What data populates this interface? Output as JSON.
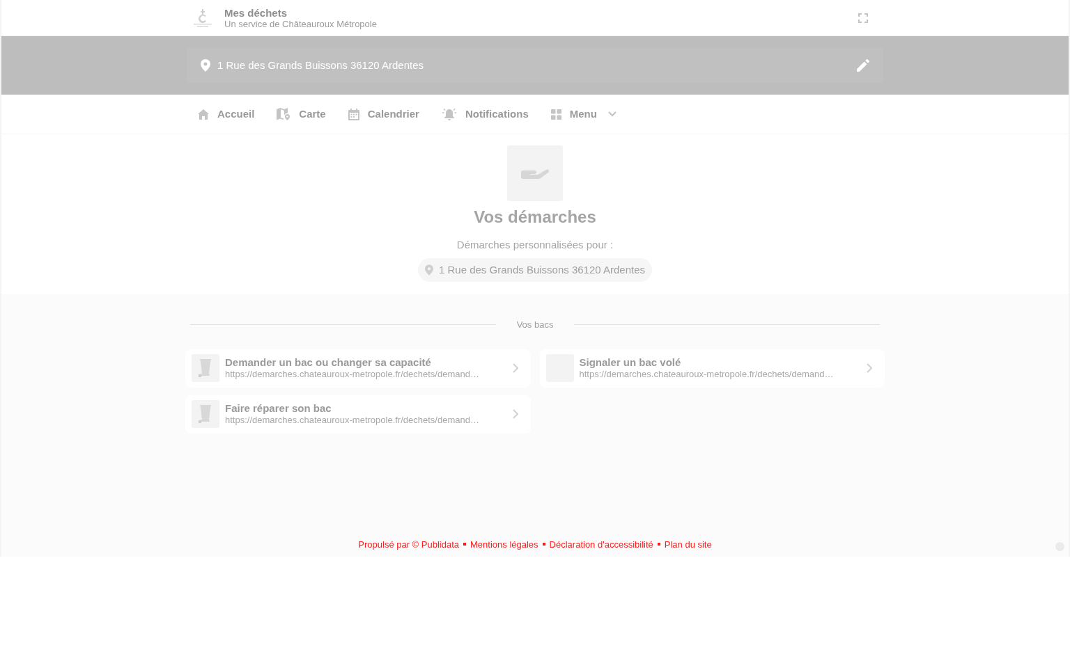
{
  "header": {
    "title": "Mes déchets",
    "subtitle": "Un service de Châteauroux Métropole"
  },
  "address_bar": {
    "address": "1 Rue des Grands Buissons 36120 Ardentes"
  },
  "nav": [
    {
      "label": "Accueil",
      "kind": "link",
      "selected": false
    },
    {
      "label": "Carte",
      "kind": "link",
      "selected": false
    },
    {
      "label": "Calendrier",
      "kind": "link",
      "selected": false
    },
    {
      "label": "Notifications",
      "kind": "link",
      "selected": false
    },
    {
      "label": "Menu",
      "kind": "dropdown",
      "selected": false,
      "expanded": false
    }
  ],
  "hero": {
    "title": "Vos démarches",
    "subtitle": "Démarches personnalisées pour :",
    "address": "1 Rue des Grands Buissons 36120 Ardentes"
  },
  "section": {
    "title": "Vos bacs",
    "items": [
      {
        "title": "Demander un bac ou changer sa capacité",
        "url": "https://demarches.chateauroux-metropole.fr/dechets/demand…",
        "kind": "bin"
      },
      {
        "title": "Signaler un bac volé",
        "url": "https://demarches.chateauroux-metropole.fr/dechets/demand…",
        "kind": "plain"
      },
      {
        "title": "Faire réparer son bac",
        "url": "https://demarches.chateauroux-metropole.fr/dechets/demand…",
        "kind": "bin"
      }
    ]
  },
  "footer": {
    "links": [
      "Propulsé par © Publidata",
      "Mentions légales",
      "Déclaration d'accessibilité",
      "Plan du site"
    ]
  }
}
